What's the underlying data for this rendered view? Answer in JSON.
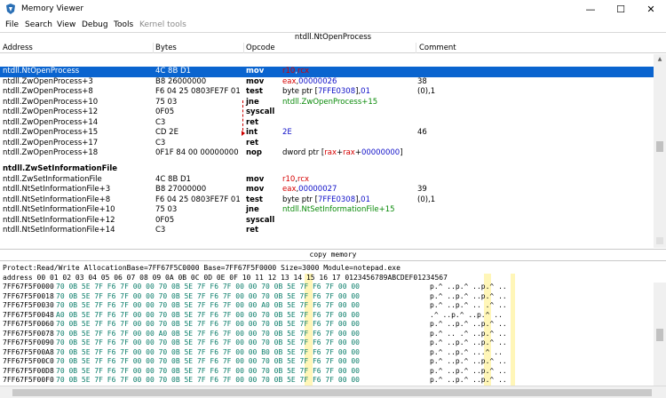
{
  "window": {
    "title": "Memory Viewer",
    "icon": "cheat-engine-icon",
    "controls": {
      "minimize": "—",
      "maximize": "☐",
      "close": "✕"
    }
  },
  "menu": {
    "items": [
      "File",
      "Search",
      "View",
      "Debug",
      "Tools",
      "Kernel tools"
    ]
  },
  "disassembler": {
    "function_bar": "ntdll.NtOpenProcess",
    "columns": [
      "Address",
      "Bytes",
      "Opcode",
      "Comment"
    ],
    "rows": [
      {
        "kind": "header",
        "addr": "ntdll.NtOpenProcess",
        "selected": true
      },
      {
        "addr": "ntdll.NtOpenProcess",
        "bytes": "4C 8B D1",
        "op": "mov",
        "args": [
          [
            "reg",
            "r10"
          ],
          [
            "plain",
            ","
          ],
          [
            "reg",
            "rcx"
          ]
        ],
        "comment": "",
        "selected": true
      },
      {
        "addr": "ntdll.ZwOpenProcess+3",
        "bytes": "B8 26000000",
        "op": "mov",
        "args": [
          [
            "reg",
            "eax"
          ],
          [
            "plain",
            ","
          ],
          [
            "num",
            "00000026"
          ]
        ],
        "comment": "38"
      },
      {
        "addr": "ntdll.ZwOpenProcess+8",
        "bytes": "F6 04 25 0803FE7F 01",
        "op": "test",
        "args": [
          [
            "plain",
            "byte ptr ["
          ],
          [
            "num",
            "7FFE0308"
          ],
          [
            "plain",
            "],"
          ],
          [
            "num",
            "01"
          ]
        ],
        "comment": "(0),1"
      },
      {
        "addr": "ntdll.ZwOpenProcess+10",
        "bytes": "75 03",
        "op": "jne",
        "args": [
          [
            "sym",
            "ntdll.ZwOpenProcess+15"
          ]
        ],
        "comment": ""
      },
      {
        "addr": "ntdll.ZwOpenProcess+12",
        "bytes": "0F05",
        "op": "syscall",
        "args": [],
        "comment": ""
      },
      {
        "addr": "ntdll.ZwOpenProcess+14",
        "bytes": "C3",
        "op": "ret",
        "args": [],
        "comment": ""
      },
      {
        "addr": "ntdll.ZwOpenProcess+15",
        "bytes": "CD 2E",
        "op": "int",
        "args": [
          [
            "num",
            "2E"
          ]
        ],
        "comment": "46"
      },
      {
        "addr": "ntdll.ZwOpenProcess+17",
        "bytes": "C3",
        "op": "ret",
        "args": [],
        "comment": ""
      },
      {
        "addr": "ntdll.ZwOpenProcess+18",
        "bytes": "0F1F 84 00 00000000",
        "op": "nop",
        "args": [
          [
            "plain",
            "dword ptr ["
          ],
          [
            "reg",
            "rax"
          ],
          [
            "plain",
            "+"
          ],
          [
            "reg",
            "rax"
          ],
          [
            "plain",
            "+"
          ],
          [
            "num",
            "00000000"
          ],
          [
            "plain",
            "]"
          ]
        ],
        "comment": ""
      },
      {
        "kind": "header",
        "addr": "ntdll.ZwSetInformationFile"
      },
      {
        "addr": "ntdll.ZwSetInformationFile",
        "bytes": "4C 8B D1",
        "op": "mov",
        "args": [
          [
            "reg",
            "r10"
          ],
          [
            "plain",
            ","
          ],
          [
            "reg",
            "rcx"
          ]
        ],
        "comment": ""
      },
      {
        "addr": "ntdll.NtSetInformationFile+3",
        "bytes": "B8 27000000",
        "op": "mov",
        "args": [
          [
            "reg",
            "eax"
          ],
          [
            "plain",
            ","
          ],
          [
            "num",
            "00000027"
          ]
        ],
        "comment": "39"
      },
      {
        "addr": "ntdll.NtSetInformationFile+8",
        "bytes": "F6 04 25 0803FE7F 01",
        "op": "test",
        "args": [
          [
            "plain",
            "byte ptr ["
          ],
          [
            "num",
            "7FFE0308"
          ],
          [
            "plain",
            "],"
          ],
          [
            "num",
            "01"
          ]
        ],
        "comment": "(0),1"
      },
      {
        "addr": "ntdll.NtSetInformationFile+10",
        "bytes": "75 03",
        "op": "jne",
        "args": [
          [
            "sym",
            "ntdll.NtSetInformationFile+15"
          ]
        ],
        "comment": ""
      },
      {
        "addr": "ntdll.NtSetInformationFile+12",
        "bytes": "0F05",
        "op": "syscall",
        "args": [],
        "comment": ""
      },
      {
        "addr": "ntdll.NtSetInformationFile+14",
        "bytes": "C3",
        "op": "ret",
        "args": [],
        "comment": ""
      }
    ]
  },
  "copy_bar": "copy memory",
  "hexview": {
    "protection_line": "Protect:Read/Write  AllocationBase=7FF67F5C0000 Base=7FF67F5F0000 Size=3000 Module=notepad.exe",
    "header": "address     00 01 02 03 04 05 06 07 08 09 0A 0B 0C 0D 0E 0F 10 11 12 13 14 15 16 17 0123456789ABCDEF01234567",
    "rows": [
      {
        "addr": "7FF67F5F0000",
        "bytes": "70 0B 5E 7F F6 7F 00 00 70 0B 5E 7F F6 7F 00 00 70 0B 5E 7F F6 7F 00 00",
        "ascii": "p.^ ..p.^ ..p.^ .."
      },
      {
        "addr": "7FF67F5F0018",
        "bytes": "70 0B 5E 7F F6 7F 00 00 70 0B 5E 7F F6 7F 00 00 70 0B 5E 7F F6 7F 00 00",
        "ascii": "p.^ ..p.^ ..p.^ .."
      },
      {
        "addr": "7FF67F5F0030",
        "bytes": "70 0B 5E 7F F6 7F 00 00 70 0B 5E 7F F6 7F 00 00 A0 0B 5E 7F F6 7F 00 00",
        "ascii": "p.^ ..p.^ .. .^ .."
      },
      {
        "addr": "7FF67F5F0048",
        "bytes": "A0 0B 5E 7F F6 7F 00 00 70 0B 5E 7F F6 7F 00 00 70 0B 5E 7F F6 7F 00 00",
        "ascii": " .^ ..p.^ ..p.^ .."
      },
      {
        "addr": "7FF67F5F0060",
        "bytes": "70 0B 5E 7F F6 7F 00 00 70 0B 5E 7F F6 7F 00 00 70 0B 5E 7F F6 7F 00 00",
        "ascii": "p.^ ..p.^ ..p.^ .."
      },
      {
        "addr": "7FF67F5F0078",
        "bytes": "70 0B 5E 7F F6 7F 00 00 A0 0B 5E 7F F6 7F 00 00 70 0B 5E 7F F6 7F 00 00",
        "ascii": "p.^ .. .^ ..p.^ .."
      },
      {
        "addr": "7FF67F5F0090",
        "bytes": "70 0B 5E 7F F6 7F 00 00 70 0B 5E 7F F6 7F 00 00 70 0B 5E 7F F6 7F 00 00",
        "ascii": "p.^ ..p.^ ..p.^ .."
      },
      {
        "addr": "7FF67F5F00A8",
        "bytes": "70 0B 5E 7F F6 7F 00 00 70 0B 5E 7F F6 7F 00 00 B0 0B 5E 7F F6 7F 00 00",
        "ascii": "p.^ ..p.^ ...^ .."
      },
      {
        "addr": "7FF67F5F00C0",
        "bytes": "70 0B 5E 7F F6 7F 00 00 70 0B 5E 7F F6 7F 00 00 70 0B 5E 7F F6 7F 00 00",
        "ascii": "p.^ ..p.^ ..p.^ .."
      },
      {
        "addr": "7FF67F5F00D8",
        "bytes": "70 0B 5E 7F F6 7F 00 00 70 0B 5E 7F F6 7F 00 00 70 0B 5E 7F F6 7F 00 00",
        "ascii": "p.^ ..p.^ ..p.^ .."
      },
      {
        "addr": "7FF67F5F00F0",
        "bytes": "70 0B 5E 7F F6 7F 00 00 70 0B 5E 7F F6 7F 00 00 70 0B 5E 7F F6 7F 00 00",
        "ascii": "p.^ ..p.^ ..p.^ .."
      }
    ]
  },
  "colors": {
    "selection": "#0a64cf",
    "register": "#d60000",
    "number": "#1010c8",
    "symbol": "#0a8a0a",
    "hex_bytes": "#0a7d6a"
  }
}
